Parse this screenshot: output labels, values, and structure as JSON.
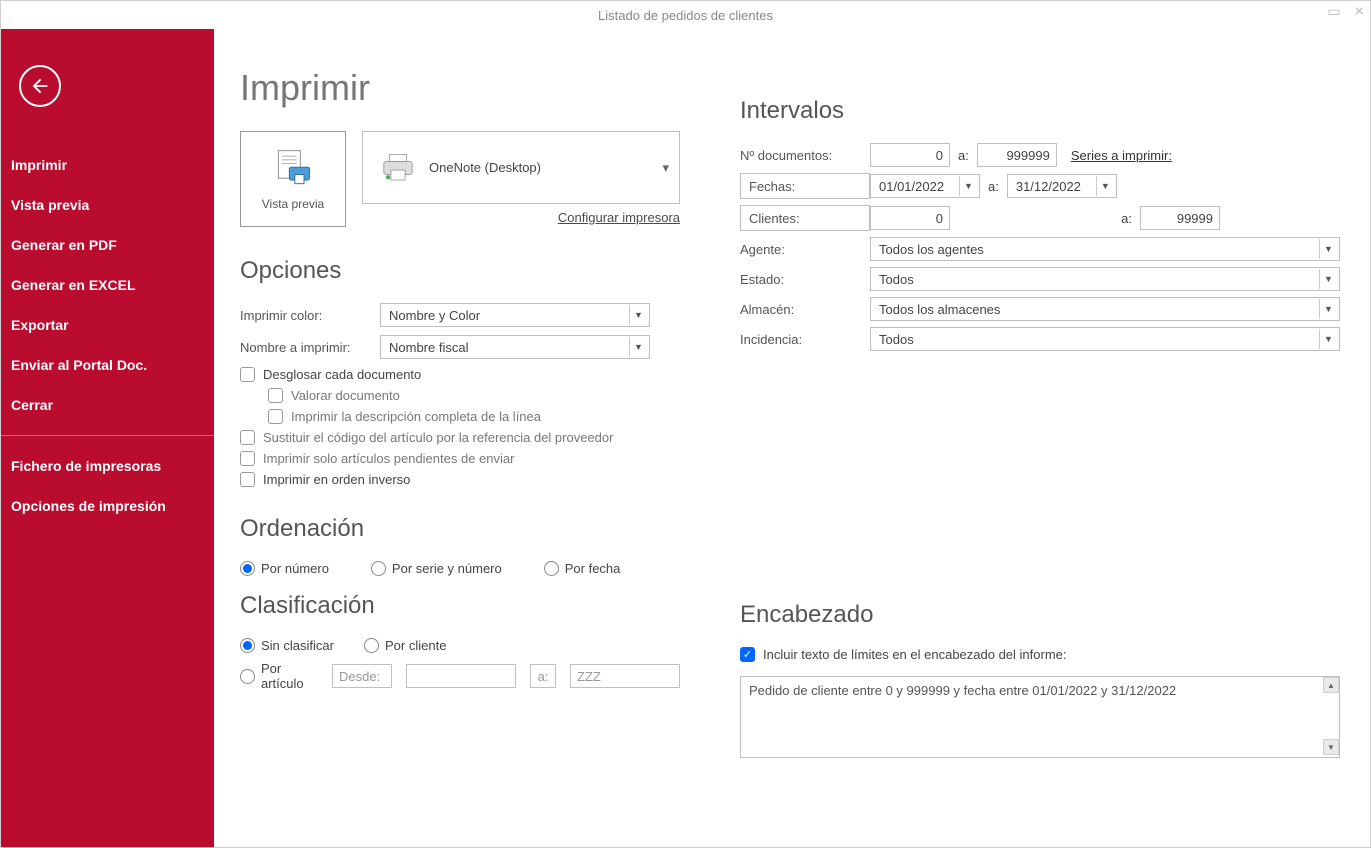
{
  "window": {
    "title": "Listado de pedidos de clientes"
  },
  "sidebar": {
    "items": [
      "Imprimir",
      "Vista previa",
      "Generar en PDF",
      "Generar en EXCEL",
      "Exportar",
      "Enviar al Portal Doc.",
      "Cerrar"
    ],
    "items2": [
      "Fichero de impresoras",
      "Opciones de impresión"
    ]
  },
  "headings": {
    "imprimir": "Imprimir",
    "opciones": "Opciones",
    "ordenacion": "Ordenación",
    "clasificacion": "Clasificación",
    "intervalos": "Intervalos",
    "encabezado": "Encabezado"
  },
  "preview": {
    "tile_label": "Vista previa",
    "printer_name": "OneNote (Desktop)",
    "configure_link": "Configurar impresora"
  },
  "options": {
    "color_label": "Imprimir color:",
    "color_value": "Nombre y Color",
    "name_label": "Nombre a imprimir:",
    "name_value": "Nombre fiscal",
    "checks": {
      "desglosar": "Desglosar cada documento",
      "valorar": "Valorar documento",
      "imprimir_desc": "Imprimir la descripción completa de la línea",
      "sustituir": "Sustituir el código del artículo por la referencia del proveedor",
      "solo_pendientes": "Imprimir solo artículos pendientes de enviar",
      "orden_inverso": "Imprimir en orden inverso"
    }
  },
  "sort": {
    "numero": "Por número",
    "serie": "Por serie y número",
    "fecha": "Por fecha"
  },
  "class": {
    "sin": "Sin clasificar",
    "cliente": "Por cliente",
    "articulo": "Por artículo",
    "desde_label": "Desde:",
    "a_label": "a:",
    "a_value": "ZZZ"
  },
  "intervals": {
    "doc_label": "Nº documentos:",
    "doc_from": "0",
    "a": "a:",
    "doc_to": "999999",
    "series_link": "Series a imprimir:",
    "fechas_label": "Fechas:",
    "fecha_from": "01/01/2022",
    "fecha_to": "31/12/2022",
    "clientes_label": "Clientes:",
    "cli_from": "0",
    "cli_to": "99999",
    "agente_label": "Agente:",
    "agente_value": "Todos los agentes",
    "estado_label": "Estado:",
    "estado_value": "Todos",
    "almacen_label": "Almacén:",
    "almacen_value": "Todos los almacenes",
    "incidencia_label": "Incidencia:",
    "incidencia_value": "Todos"
  },
  "header_section": {
    "check_label": "Incluir texto de límites en el encabezado del informe:",
    "text": "Pedido de cliente entre 0 y 999999 y fecha entre 01/01/2022 y 31/12/2022"
  }
}
